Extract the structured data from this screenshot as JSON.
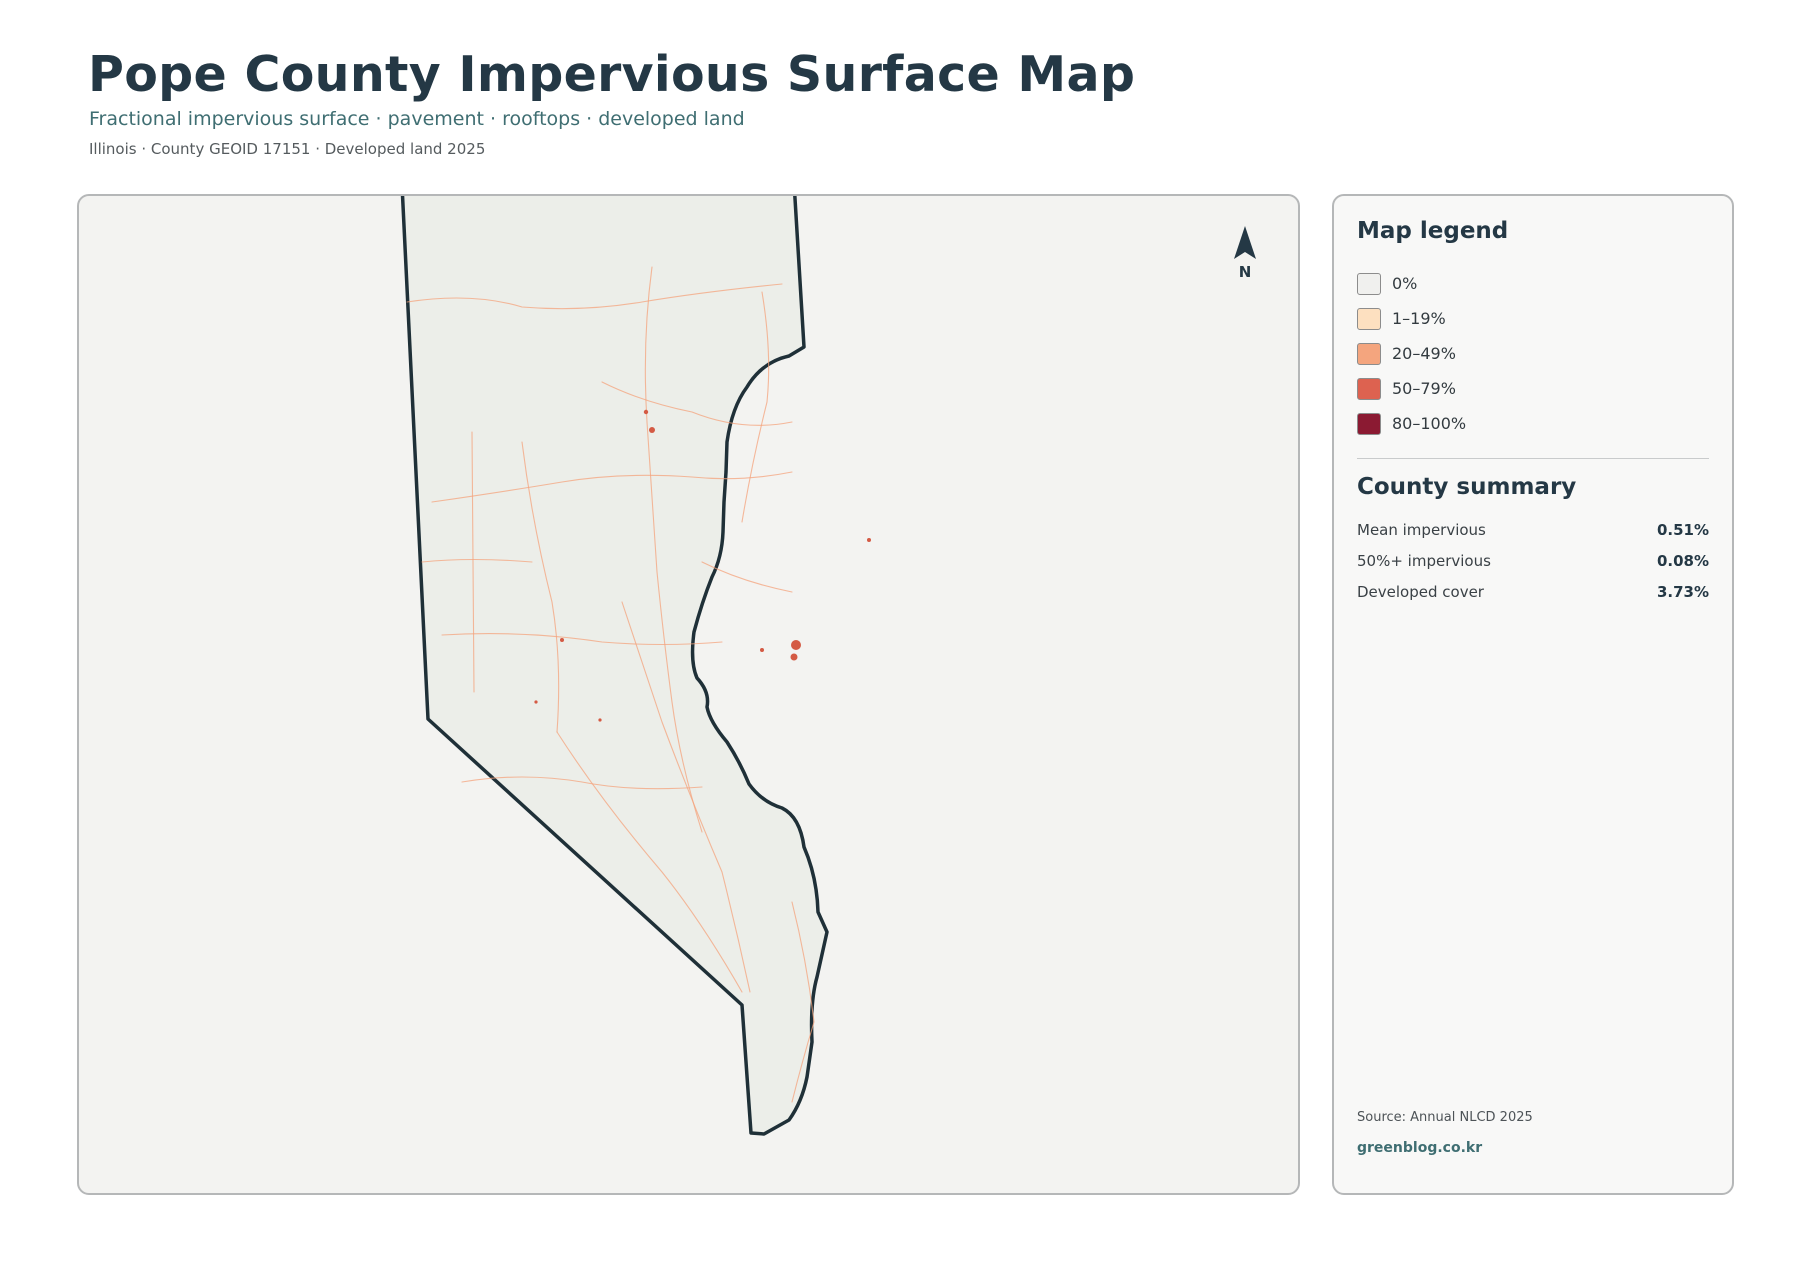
{
  "header": {
    "title": "Pope County Impervious Surface Map",
    "subtitle": "Fractional impervious surface · pavement · rooftops · developed land",
    "meta": "Illinois · County GEOID 17151 · Developed land 2025"
  },
  "map": {
    "north_label": "N",
    "county_fill": "#eceee9",
    "county_outline": "#1f3038",
    "road_color": "#f4a37c",
    "developed_color": "#d45a44"
  },
  "legend": {
    "title": "Map legend",
    "items": [
      {
        "label": "0%",
        "color": "#f0f0ee"
      },
      {
        "label": "1–19%",
        "color": "#fde0c0"
      },
      {
        "label": "20–49%",
        "color": "#f4a57e"
      },
      {
        "label": "50–79%",
        "color": "#dd6250"
      },
      {
        "label": "80–100%",
        "color": "#8b1a32"
      }
    ]
  },
  "summary": {
    "title": "County summary",
    "rows": [
      {
        "label": "Mean impervious",
        "value": "0.51%"
      },
      {
        "label": "50%+ impervious",
        "value": "0.08%"
      },
      {
        "label": "Developed cover",
        "value": "3.73%"
      }
    ]
  },
  "footer": {
    "source": "Source: Annual NLCD 2025",
    "credit": "greenblog.co.kr"
  }
}
